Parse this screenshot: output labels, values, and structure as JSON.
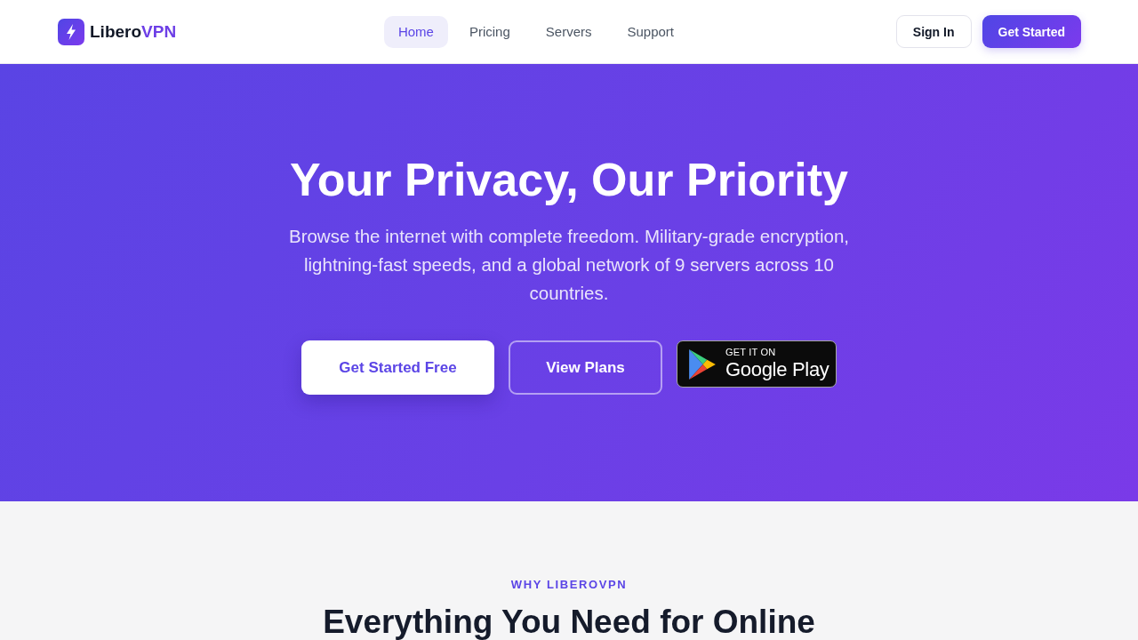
{
  "brand": {
    "name": "Libero",
    "accent": "VPN"
  },
  "nav": [
    {
      "label": "Home",
      "selected": true
    },
    {
      "label": "Pricing",
      "selected": false
    },
    {
      "label": "Servers",
      "selected": false
    },
    {
      "label": "Support",
      "selected": false
    }
  ],
  "header_actions": [
    {
      "label": "Sign In",
      "kind": "outline"
    },
    {
      "label": "Get Started",
      "kind": "primary"
    }
  ],
  "hero": {
    "title": "Your Privacy, Our Priority",
    "subtitle": "Browse the internet with complete freedom. Military-grade encryption, lightning-fast speeds, and a global network of 9 servers across 10 countries.",
    "actions": [
      {
        "label": "Get Started Free",
        "kind": "solid"
      },
      {
        "label": "View Plans",
        "kind": "outline"
      }
    ],
    "store_badge": {
      "caption": "GET IT ON",
      "store": "Google Play"
    }
  },
  "features": {
    "eyebrow": "WHY LIBEROVPN",
    "title": "Everything You Need for Online"
  }
}
